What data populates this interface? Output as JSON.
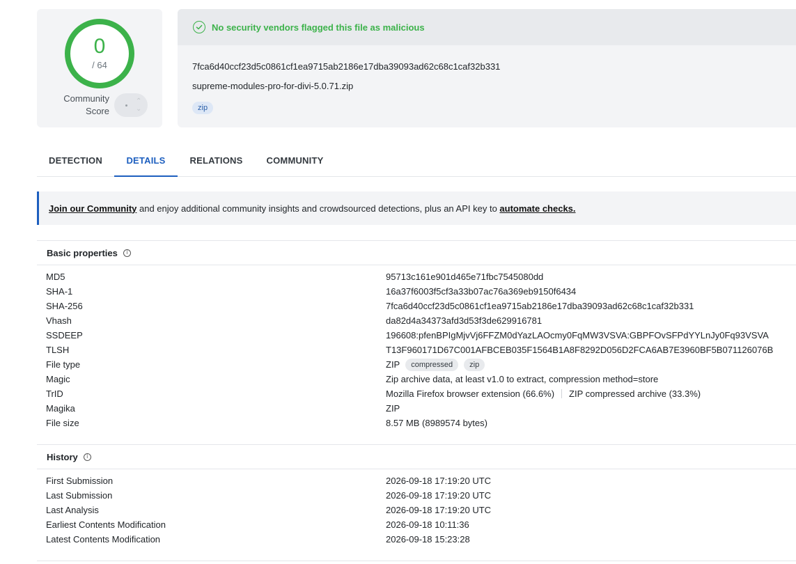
{
  "score": {
    "detections": "0",
    "total": "/ 64",
    "community_label_1": "Community",
    "community_label_2": "Score"
  },
  "file": {
    "status": "No security vendors flagged this file as malicious",
    "hash": "7fca6d40ccf23d5c0861cf1ea9715ab2186e17dba39093ad62c68c1caf32b331",
    "name": "supreme-modules-pro-for-divi-5.0.71.zip",
    "tag": "zip"
  },
  "tabs": [
    {
      "label": "DETECTION"
    },
    {
      "label": "DETAILS"
    },
    {
      "label": "RELATIONS"
    },
    {
      "label": "COMMUNITY"
    }
  ],
  "banner": {
    "link1": "Join our Community",
    "middle": " and enjoy additional community insights and crowdsourced detections, plus an API key to ",
    "link2": "automate checks."
  },
  "basic": {
    "title": "Basic properties",
    "md5": {
      "k": "MD5",
      "v": "95713c161e901d465e71fbc7545080dd"
    },
    "sha1": {
      "k": "SHA-1",
      "v": "16a37f6003f5cf3a33b07ac76a369eb9150f6434"
    },
    "sha256": {
      "k": "SHA-256",
      "v": "7fca6d40ccf23d5c0861cf1ea9715ab2186e17dba39093ad62c68c1caf32b331"
    },
    "vhash": {
      "k": "Vhash",
      "v": "da82d4a34373afd3d53f3de629916781"
    },
    "ssdeep": {
      "k": "SSDEEP",
      "v": "196608:pfenBPIgMjvVj6FFZM0dYazLAOcmy0FqMW3VSVA:GBPFOvSFPdYYLnJy0Fq93VSVA"
    },
    "tlsh": {
      "k": "TLSH",
      "v": "T13F960171D67C001AFBCEB035F1564B1A8F8292D056D2FCA6AB7E3960BF5B071126076B"
    },
    "filetype": {
      "k": "File type",
      "v": "ZIP",
      "pill1": "compressed",
      "pill2": "zip"
    },
    "magic": {
      "k": "Magic",
      "v": "Zip archive data, at least v1.0 to extract, compression method=store"
    },
    "trid": {
      "k": "TrID",
      "v1": "Mozilla Firefox browser extension (66.6%)",
      "v2": "ZIP compressed archive (33.3%)"
    },
    "magika": {
      "k": "Magika",
      "v": "ZIP"
    },
    "filesize": {
      "k": "File size",
      "v": "8.57 MB (8989574 bytes)"
    }
  },
  "history": {
    "title": "History",
    "first": {
      "k": "First Submission",
      "v": "2026-09-18 17:19:20 UTC"
    },
    "last": {
      "k": "Last Submission",
      "v": "2026-09-18 17:19:20 UTC"
    },
    "analysis": {
      "k": "Last Analysis",
      "v": "2026-09-18 17:19:20 UTC"
    },
    "earliest": {
      "k": "Earliest Contents Modification",
      "v": "2026-09-18 10:11:36"
    },
    "latest": {
      "k": "Latest Contents Modification",
      "v": "2026-09-18 15:23:28"
    }
  },
  "colors": {
    "clean": "#3cb24a",
    "accent": "#1d5fbf"
  },
  "icons": {
    "status": "check-circle-icon",
    "info": "info-icon",
    "toggle": "community-score-toggle"
  }
}
